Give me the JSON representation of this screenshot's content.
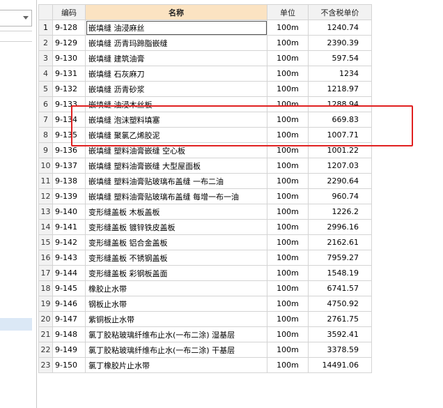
{
  "columns": {
    "code": "编码",
    "name": "名称",
    "unit": "单位",
    "price": "不含税单价"
  },
  "rows": [
    {
      "num": "1",
      "code": "9-128",
      "name": "嵌填缝 油浸麻丝",
      "unit": "100m",
      "price": "1240.74"
    },
    {
      "num": "2",
      "code": "9-129",
      "name": "嵌填缝 沥青玛蹄脂嵌缝",
      "unit": "100m",
      "price": "2390.39"
    },
    {
      "num": "3",
      "code": "9-130",
      "name": "嵌填缝 建筑油膏",
      "unit": "100m",
      "price": "597.54"
    },
    {
      "num": "4",
      "code": "9-131",
      "name": "嵌填缝 石灰麻刀",
      "unit": "100m",
      "price": "1234"
    },
    {
      "num": "5",
      "code": "9-132",
      "name": "嵌填缝 沥青砂浆",
      "unit": "100m",
      "price": "1218.97"
    },
    {
      "num": "6",
      "code": "9-133",
      "name": "嵌填缝 油浸木丝板",
      "unit": "100m",
      "price": "1288.94"
    },
    {
      "num": "7",
      "code": "9-134",
      "name": "嵌填缝 泡沫塑料填塞",
      "unit": "100m",
      "price": "669.83"
    },
    {
      "num": "8",
      "code": "9-135",
      "name": "嵌填缝 聚氯乙烯胶泥",
      "unit": "100m",
      "price": "1007.71"
    },
    {
      "num": "9",
      "code": "9-136",
      "name": "嵌填缝 塑料油膏嵌缝 空心板",
      "unit": "100m",
      "price": "1001.22"
    },
    {
      "num": "10",
      "code": "9-137",
      "name": "嵌填缝 塑料油膏嵌缝 大型屋面板",
      "unit": "100m",
      "price": "1207.03"
    },
    {
      "num": "11",
      "code": "9-138",
      "name": "嵌填缝 塑料油膏贴玻璃布盖缝 一布二油",
      "unit": "100m",
      "price": "2290.64"
    },
    {
      "num": "12",
      "code": "9-139",
      "name": "嵌填缝 塑料油膏贴玻璃布盖缝 每增一布一油",
      "unit": "100m",
      "price": "960.74"
    },
    {
      "num": "13",
      "code": "9-140",
      "name": "变形缝盖板 木板盖板",
      "unit": "100m",
      "price": "1226.2"
    },
    {
      "num": "14",
      "code": "9-141",
      "name": "变形缝盖板 镀锌铁皮盖板",
      "unit": "100m",
      "price": "2996.16"
    },
    {
      "num": "15",
      "code": "9-142",
      "name": "变形缝盖板 铝合金盖板",
      "unit": "100m",
      "price": "2162.61"
    },
    {
      "num": "16",
      "code": "9-143",
      "name": "变形缝盖板 不锈钢盖板",
      "unit": "100m",
      "price": "7959.27"
    },
    {
      "num": "17",
      "code": "9-144",
      "name": "变形缝盖板 彩钢板盖面",
      "unit": "100m",
      "price": "1548.19"
    },
    {
      "num": "18",
      "code": "9-145",
      "name": "橡胶止水带",
      "unit": "100m",
      "price": "6741.57"
    },
    {
      "num": "19",
      "code": "9-146",
      "name": "钢板止水带",
      "unit": "100m",
      "price": "4750.92"
    },
    {
      "num": "20",
      "code": "9-147",
      "name": "紫铜板止水带",
      "unit": "100m",
      "price": "2761.75"
    },
    {
      "num": "21",
      "code": "9-148",
      "name": "氯丁胶粘玻璃纤维布止水(一布二涂) 湿基层",
      "unit": "100m",
      "price": "3592.41"
    },
    {
      "num": "22",
      "code": "9-149",
      "name": "氯丁胶粘玻璃纤维布止水(一布二涂) 干基层",
      "unit": "100m",
      "price": "3378.59"
    },
    {
      "num": "23",
      "code": "9-150",
      "name": "氯丁橡胶片止水带",
      "unit": "100m",
      "price": "14491.06"
    }
  ],
  "colors": {
    "header_bg": "#f2f2f2",
    "name_header_bg": "#fbe3c2",
    "annotation": "#e02020",
    "left_highlight": "#dbe8f6"
  }
}
